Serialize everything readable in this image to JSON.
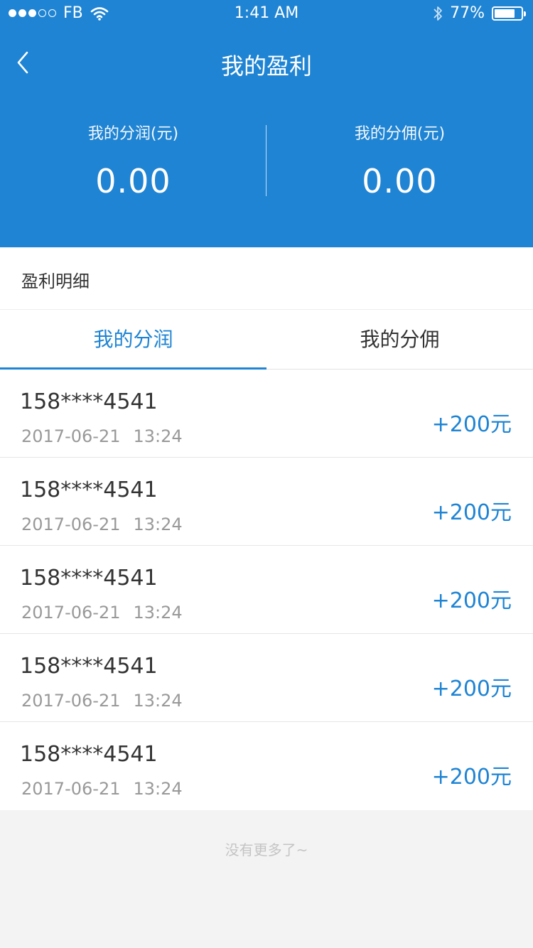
{
  "status_bar": {
    "carrier": "FB",
    "time": "1:41 AM",
    "battery": "77%",
    "battery_level": 0.77,
    "signal_bars": 3,
    "signal_total": 5
  },
  "nav": {
    "title": "我的盈利",
    "back_icon": "chevron-left-icon"
  },
  "summary": {
    "left": {
      "label": "我的分润(元)",
      "value": "0.00"
    },
    "right": {
      "label": "我的分佣(元)",
      "value": "0.00"
    }
  },
  "section": {
    "title": "盈利明细"
  },
  "tabs": [
    {
      "label": "我的分润",
      "active": true
    },
    {
      "label": "我的分佣",
      "active": false
    }
  ],
  "records": [
    {
      "phone": "158****4541",
      "date": "2017-06-21",
      "time": "13:24",
      "amount": "+200元"
    },
    {
      "phone": "158****4541",
      "date": "2017-06-21",
      "time": "13:24",
      "amount": "+200元"
    },
    {
      "phone": "158****4541",
      "date": "2017-06-21",
      "time": "13:24",
      "amount": "+200元"
    },
    {
      "phone": "158****4541",
      "date": "2017-06-21",
      "time": "13:24",
      "amount": "+200元"
    },
    {
      "phone": "158****4541",
      "date": "2017-06-21",
      "time": "13:24",
      "amount": "+200元"
    }
  ],
  "footer": "没有更多了~",
  "colors": {
    "primary": "#1f84d3",
    "background": "#f3f3f3"
  }
}
